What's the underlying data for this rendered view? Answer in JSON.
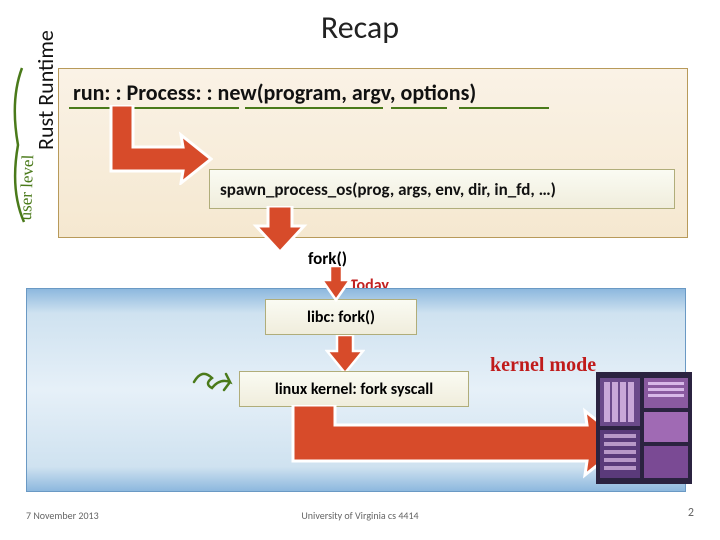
{
  "title": "Recap",
  "sidebar_label": "Rust Runtime",
  "user_level_annotation": "user level",
  "api_call": "run: : Process: : new(program, argv, options)",
  "spawn_call": "spawn_process_os(prog, args, env, dir, in_fd, …)",
  "fork_label": "fork()",
  "today_label": "Today",
  "user_level_hand": "user\nlevel",
  "libc_call": "libc: fork()",
  "kernel_call": "linux kernel: fork syscall",
  "kernel_mode_annotation": "kernel mode",
  "footer": {
    "date": "7 November 2013",
    "university": "University of Virginia cs 4414",
    "page": "2"
  },
  "colors": {
    "annotation_green": "#4a7a1a",
    "annotation_red": "#c01b1b",
    "arrow_fill": "#d74b2a",
    "arrow_stroke": "#fff"
  }
}
